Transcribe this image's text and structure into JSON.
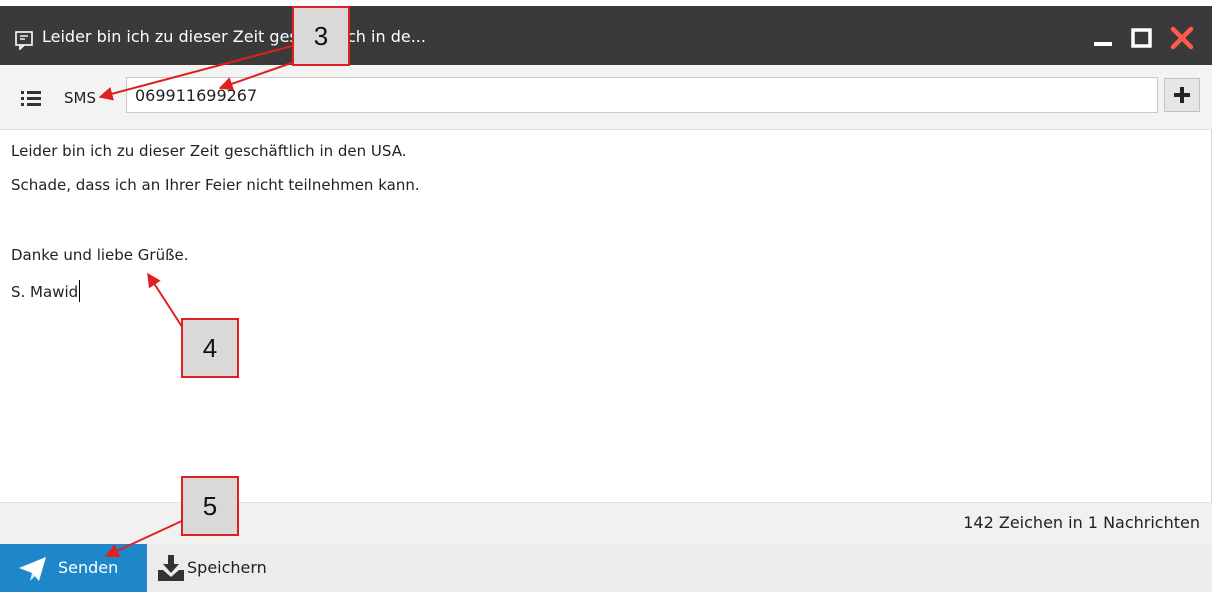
{
  "window": {
    "title": "Leider bin ich zu dieser Zeit geschäftlich in de...",
    "title_icon": "message-window-icon",
    "minimize_icon": "minimize-icon",
    "maximize_icon": "maximize-icon",
    "close_icon": "close-icon",
    "close_color": "#ff5a4f"
  },
  "toolbar": {
    "list_icon": "list-icon",
    "channel_label": "SMS",
    "recipient_value": "069911699267",
    "add_icon": "plus-icon"
  },
  "message": {
    "lines": [
      "Leider bin ich zu dieser Zeit geschäftlich in den USA.",
      "Schade, dass ich an Ihrer Feier nicht teilnehmen kann.",
      "",
      "Danke und liebe Grüße.",
      "S. Mawid"
    ]
  },
  "status": {
    "counter": "142 Zeichen in 1 Nachrichten"
  },
  "footer": {
    "send_label": "Senden",
    "send_icon": "paper-plane-icon",
    "save_label": "Speichern",
    "save_icon": "save-inbox-icon",
    "accent": "#1e87c9"
  },
  "annotations": {
    "callout_3": "3",
    "callout_4": "4",
    "callout_5": "5",
    "color": "#e02020"
  }
}
